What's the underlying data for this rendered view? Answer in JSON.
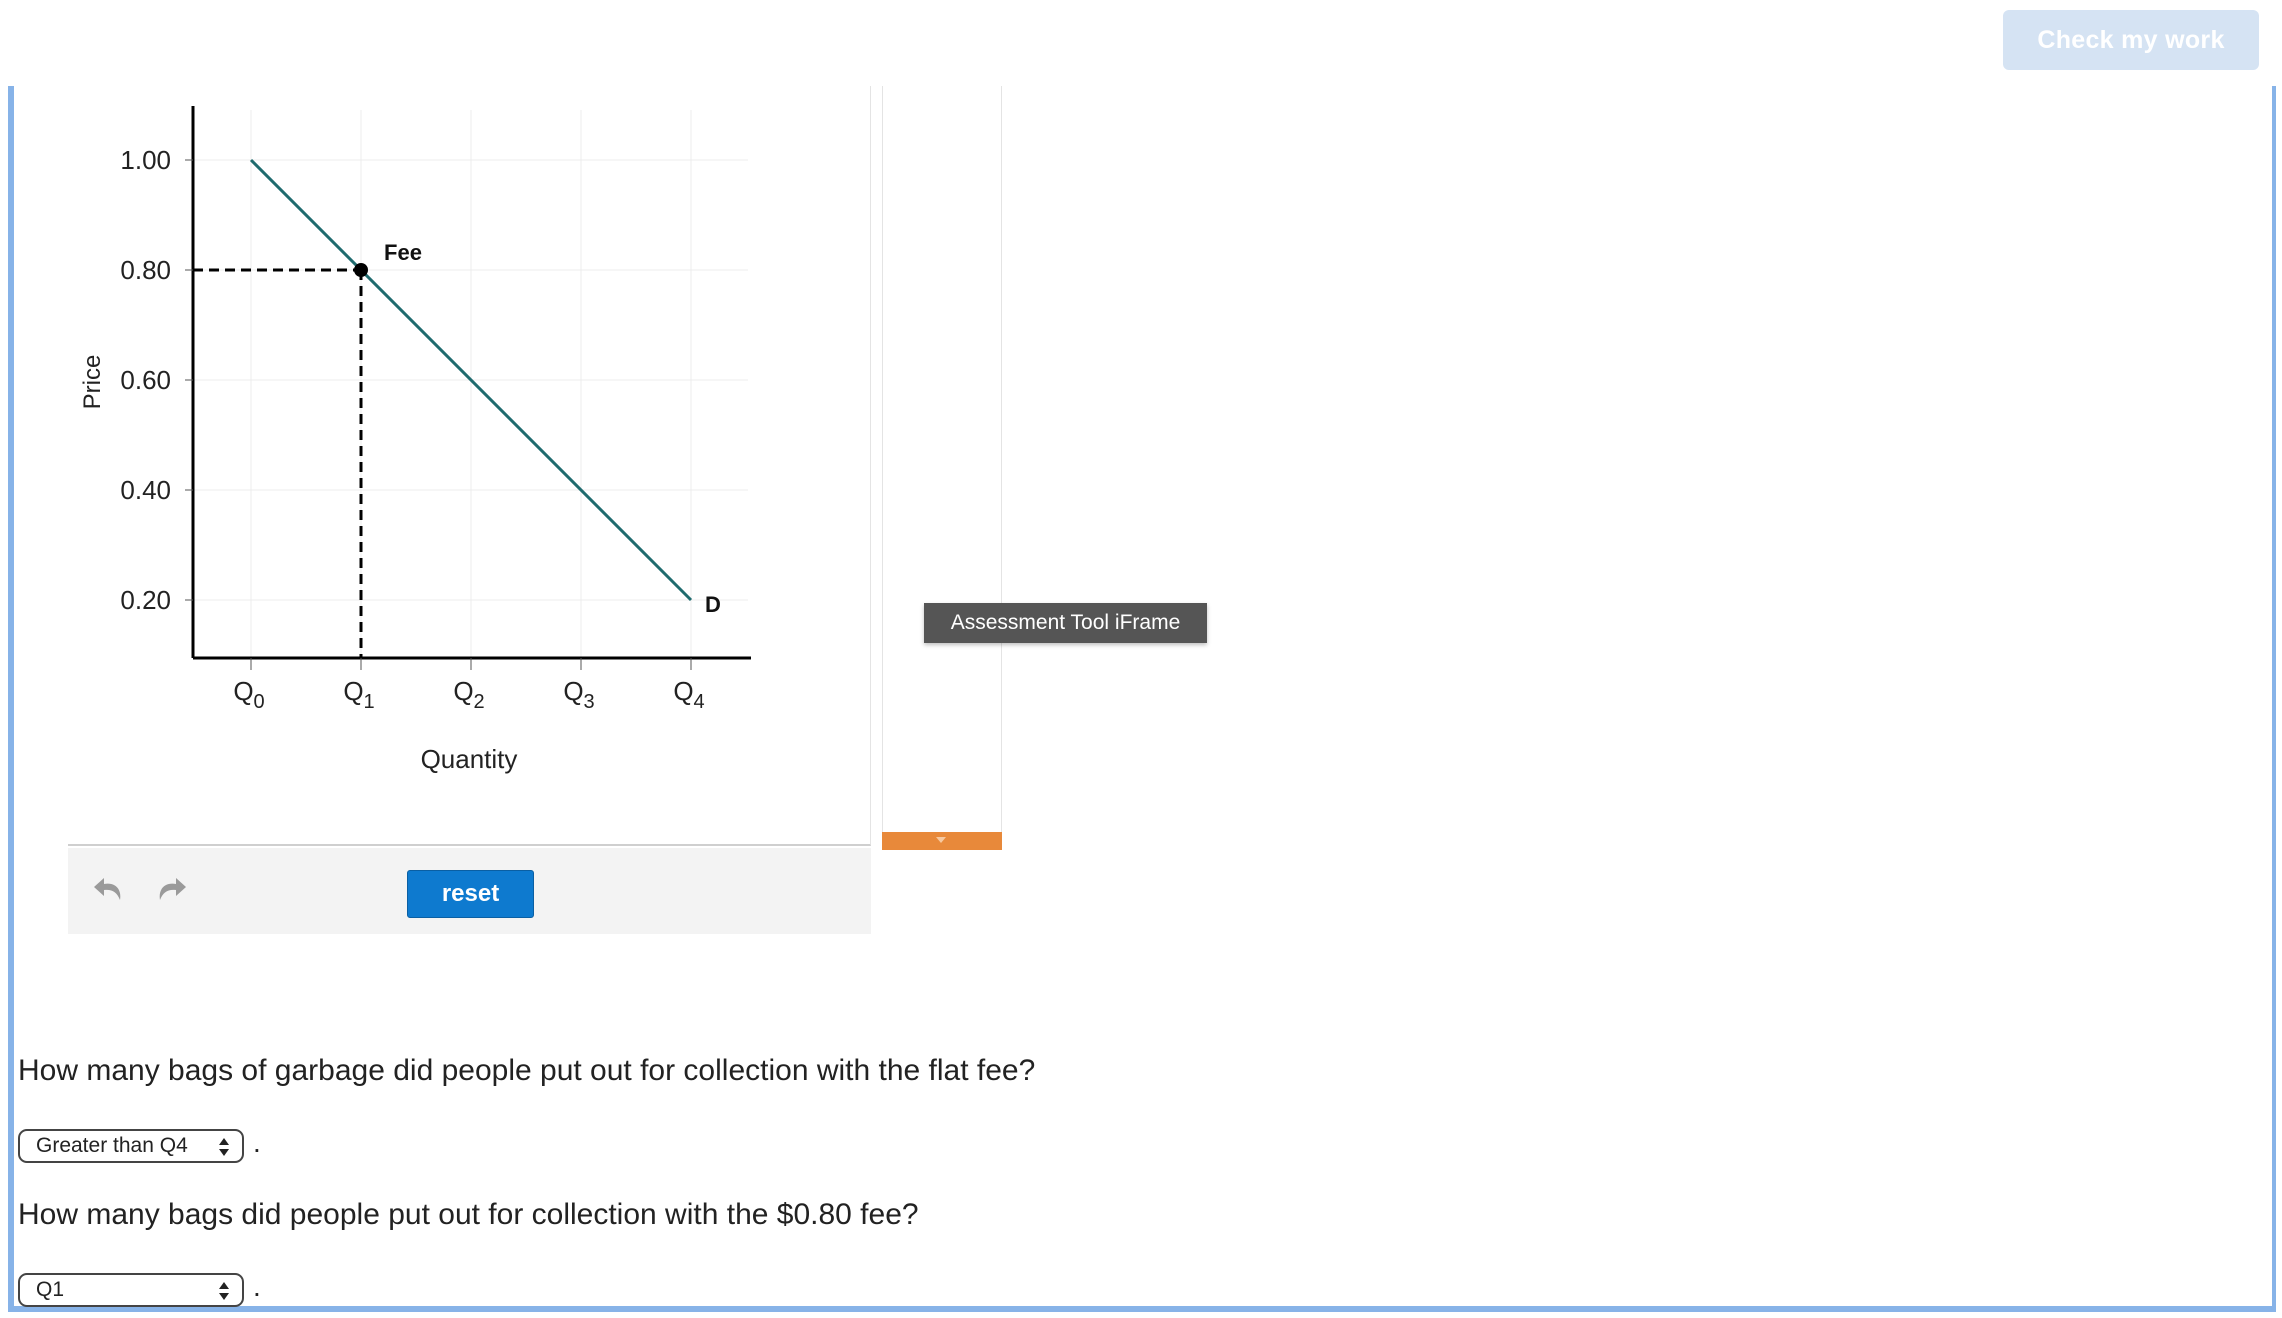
{
  "toolbar": {
    "check_label": "Check my work"
  },
  "graph": {
    "y_axis_label": "Price",
    "x_axis_label": "Quantity",
    "y_ticks": [
      "1.00",
      "0.80",
      "0.60",
      "0.40",
      "0.20"
    ],
    "x_ticks": [
      {
        "main": "Q",
        "sub": "0"
      },
      {
        "main": "Q",
        "sub": "1"
      },
      {
        "main": "Q",
        "sub": "2"
      },
      {
        "main": "Q",
        "sub": "3"
      },
      {
        "main": "Q",
        "sub": "4"
      }
    ],
    "fee_label": "Fee",
    "demand_label": "D",
    "colors": {
      "demand_line": "#1f6b6e",
      "axes": "#000000"
    }
  },
  "chart_data": {
    "type": "line",
    "xlabel": "Quantity",
    "ylabel": "Price",
    "x_categories": [
      "Q0",
      "Q1",
      "Q2",
      "Q3",
      "Q4"
    ],
    "ylim": [
      0.1,
      1.05
    ],
    "series": [
      {
        "name": "D",
        "x": [
          "Q0",
          "Q4"
        ],
        "y": [
          1.0,
          0.2
        ]
      }
    ],
    "annotations": [
      {
        "label": "Fee",
        "x": "Q1",
        "y": 0.8
      }
    ]
  },
  "controls": {
    "reset_label": "reset",
    "undo_icon": "undo-icon",
    "redo_icon": "redo-icon"
  },
  "tooltip": {
    "text": "Assessment Tool iFrame"
  },
  "questions": [
    {
      "text": "How many bags of garbage did people put out for collection with the flat fee?",
      "selected": "Greater than Q4"
    },
    {
      "text": "How many bags did people put out for collection with the $0.80 fee?",
      "selected": "Q1"
    }
  ],
  "punctuation": "."
}
